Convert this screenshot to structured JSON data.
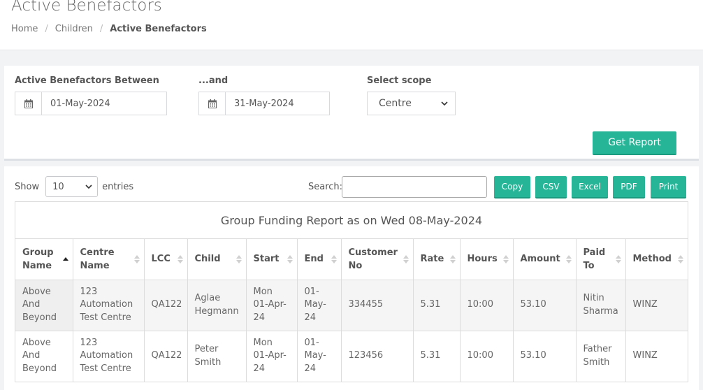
{
  "page": {
    "title": "Active Benefactors",
    "breadcrumb": [
      "Home",
      "Children",
      "Active Benefactors"
    ]
  },
  "filters": {
    "from_label": "Active Benefactors Between",
    "from_value": "01-May-2024",
    "to_label": "...and",
    "to_value": "31-May-2024",
    "scope_label": "Select scope",
    "scope_value": "Centre",
    "get_report": "Get Report"
  },
  "table_controls": {
    "show_label": "Show",
    "entries_value": "10",
    "entries_label": "entries",
    "search_label": "Search:",
    "export_buttons": [
      "Copy",
      "CSV",
      "Excel",
      "PDF",
      "Print"
    ]
  },
  "report": {
    "title": "Group Funding Report as on Wed 08-May-2024",
    "columns": [
      "Group Name",
      "Centre Name",
      "LCC",
      "Child",
      "Start",
      "End",
      "Customer No",
      "Rate",
      "Hours",
      "Amount",
      "Paid To",
      "Method"
    ],
    "rows": [
      [
        "Above And Beyond",
        "123 Automation Test Centre",
        "QA122",
        "Aglae Hegmann",
        "Mon 01-Apr-24",
        "01-May-24",
        "334455",
        "5.31",
        "10:00",
        "53.10",
        "Nitin Sharma",
        "WINZ"
      ],
      [
        "Above And Beyond",
        "123 Automation Test Centre",
        "QA122",
        "Peter Smith",
        "Mon 01-Apr-24",
        "01-May-24",
        "123456",
        "5.31",
        "10:00",
        "53.10",
        "Father Smith",
        "WINZ"
      ]
    ]
  },
  "colors": {
    "accent": "#26b597"
  }
}
